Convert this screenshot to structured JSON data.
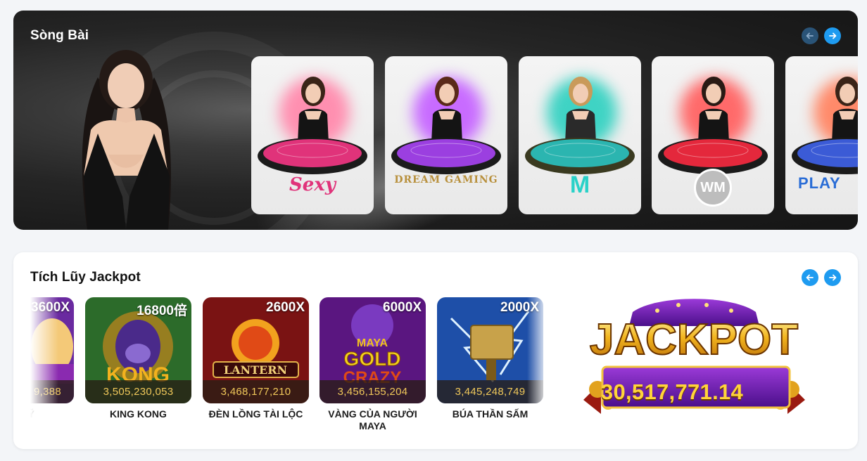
{
  "casino": {
    "title": "Sòng Bài",
    "prev_icon": "arrow-left-icon",
    "next_icon": "arrow-right-icon",
    "providers": [
      {
        "logo_text": "Sexy",
        "logo_color": "#e0337a",
        "halo": "#ff8fb0",
        "table": "#e0337a"
      },
      {
        "logo_text": "DREAM GAMING",
        "logo_color": "#b8903c",
        "halo": "#c86bff",
        "table": "#9b3fe0"
      },
      {
        "logo_text": "M",
        "logo_color": "#2ad1c8",
        "halo": "#3fd3c4",
        "table": "#2bb5b0"
      },
      {
        "logo_text": "WM",
        "logo_color": "#ffffff",
        "halo": "#ff6a6a",
        "table": "#e4283c"
      },
      {
        "logo_text": "PLAY",
        "logo_color": "#2a6dd6",
        "halo": "#ff8a6a",
        "table": "#3b5bd6"
      }
    ]
  },
  "jackpot": {
    "title": "Tích Lũy Jackpot",
    "prev_icon": "arrow-left-icon",
    "next_icon": "arrow-right-icon",
    "games": [
      {
        "mult": "3600X",
        "amount": "9,388",
        "name": "Ú MỸ",
        "bg": "#6a2aa0"
      },
      {
        "mult": "16800倍",
        "amount": "3,505,230,053",
        "name": "KING KONG",
        "bg": "#2c6b2a"
      },
      {
        "mult": "2600X",
        "amount": "3,468,177,210",
        "name": "ĐÈN LỒNG TÀI LỘC",
        "bg": "#7a1313"
      },
      {
        "mult": "6000X",
        "amount": "3,456,155,204",
        "name": "VÀNG CỦA NGƯỜI MAYA",
        "bg": "#5a1680"
      },
      {
        "mult": "2000X",
        "amount": "3,445,248,749",
        "name": "BÚA THẦN SẤM",
        "bg": "#1e4fa8"
      }
    ],
    "banner_word": "JACKPOT",
    "total": "30,517,771.14"
  },
  "colors": {
    "accent_blue": "#1e9bf0",
    "dim_blue": "#2d5e88"
  }
}
